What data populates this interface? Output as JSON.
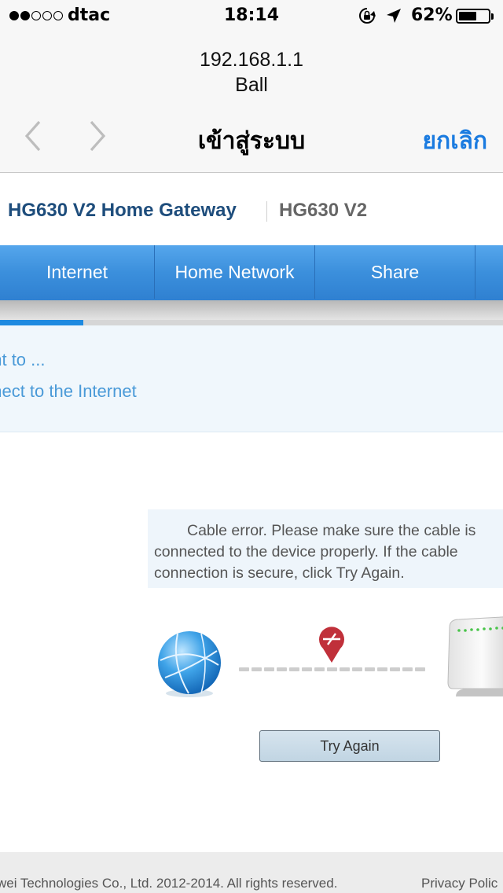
{
  "status_bar": {
    "signal_bars_filled": 2,
    "signal_bars_total": 5,
    "carrier": "dtac",
    "time": "18:14",
    "battery_percent": "62%",
    "battery_level": 0.62,
    "icons": [
      "rotation-lock-icon",
      "location-arrow-icon",
      "battery-icon"
    ]
  },
  "browser": {
    "host": "192.168.1.1",
    "host_subtitle": "Ball",
    "title": "เข้าสู่ระบบ",
    "cancel_label": "ยกเลิก",
    "icons": [
      "back-chevron-icon",
      "forward-chevron-icon"
    ]
  },
  "gateway": {
    "product_title": "HG630 V2 Home Gateway",
    "model": "HG630 V2"
  },
  "tabs": [
    {
      "label": "Internet"
    },
    {
      "label": "Home Network"
    },
    {
      "label": "Share"
    }
  ],
  "wizard": {
    "progress": 0.165,
    "question": "ant to ...",
    "option": "nnect to the Internet"
  },
  "error": {
    "message": "Cable error. Please make sure the cable is connected to the device properly. If the cable connection is secure, click Try Again.",
    "try_again_label": "Try Again",
    "icons": [
      "globe-icon",
      "cable-error-pin-icon",
      "router-icon"
    ]
  },
  "footer": {
    "copyright": "wei Technologies Co., Ltd. 2012-2014. All rights reserved.",
    "privacy": "Privacy Polic"
  },
  "colors": {
    "tab_blue": "#3b8fdc",
    "link_blue": "#1a7be0",
    "gateway_title": "#1e4d7c",
    "wizard_text": "#4a9ad8",
    "error_red": "#c0303a"
  }
}
